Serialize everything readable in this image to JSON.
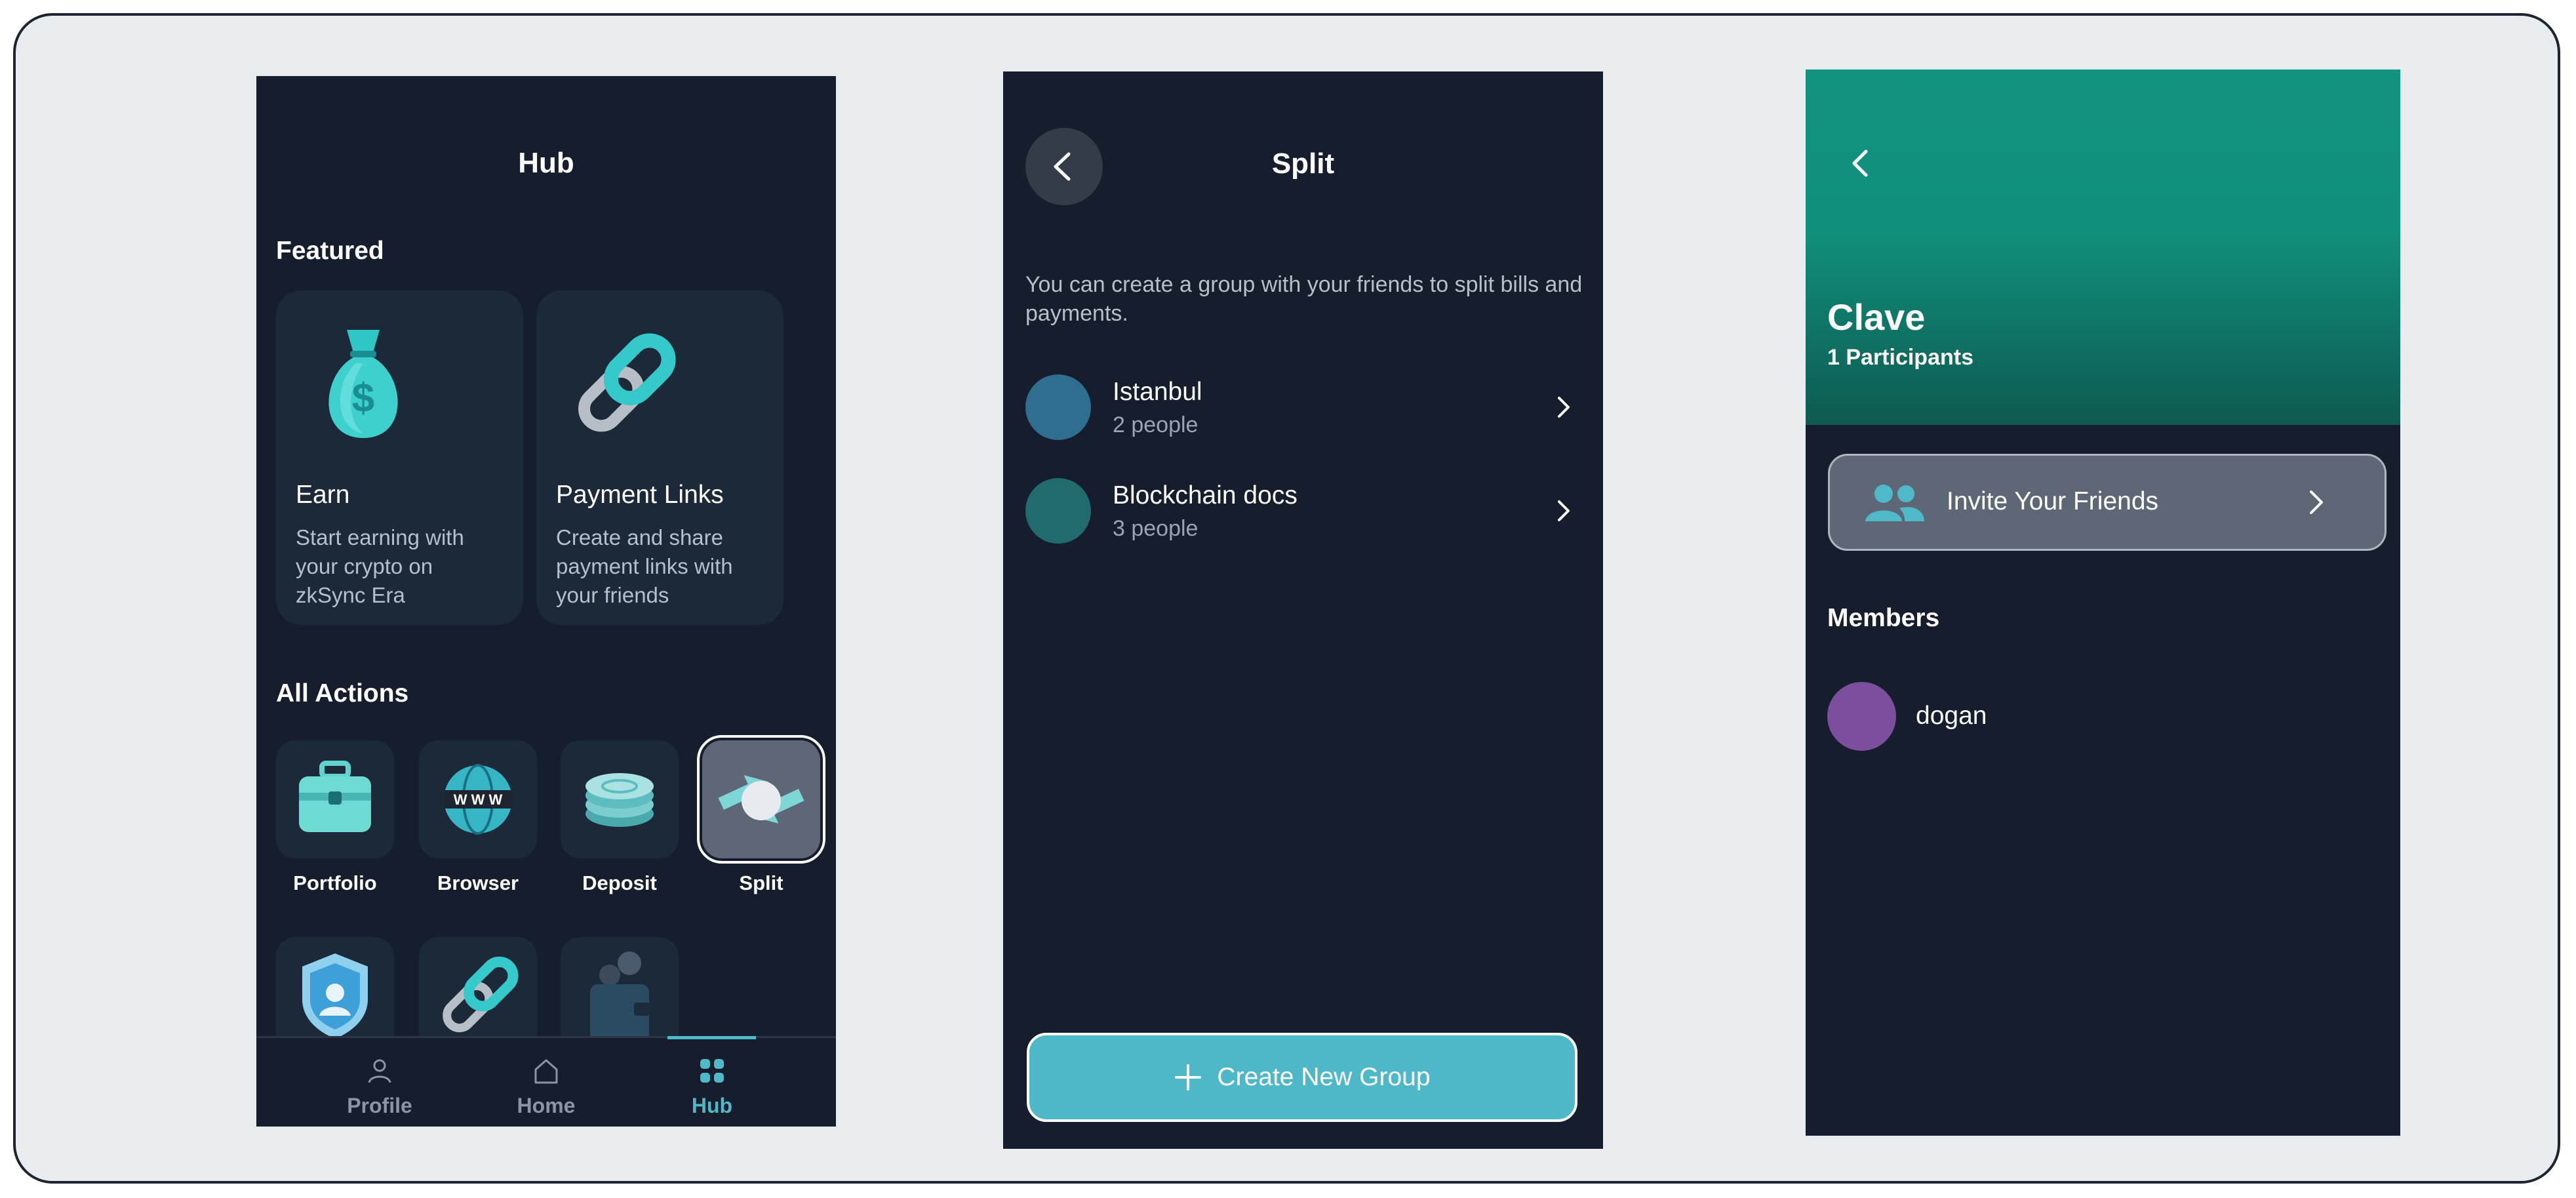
{
  "hub": {
    "title": "Hub",
    "featured_heading": "Featured",
    "featured": [
      {
        "title": "Earn",
        "description": "Start earning with your crypto on zkSync Era",
        "icon": "money-bag-icon"
      },
      {
        "title": "Payment Links",
        "description": "Create and share payment links with your friends",
        "icon": "chain-link-icon"
      }
    ],
    "actions_heading": "All Actions",
    "actions": [
      {
        "label": "Portfolio",
        "icon": "briefcase-icon"
      },
      {
        "label": "Browser",
        "icon": "globe-www-icon"
      },
      {
        "label": "Deposit",
        "icon": "coins-icon"
      },
      {
        "label": "Split",
        "icon": "split-arrows-icon",
        "selected": true
      }
    ],
    "more_actions_icons": [
      "shield-icon",
      "chain-link-icon",
      "wallet-icon"
    ],
    "tabs": [
      {
        "label": "Profile",
        "icon": "person-icon"
      },
      {
        "label": "Home",
        "icon": "home-icon"
      },
      {
        "label": "Hub",
        "icon": "grid-icon",
        "active": true
      }
    ]
  },
  "split": {
    "title": "Split",
    "description": "You can create a group with your friends to split bills and payments.",
    "groups": [
      {
        "name": "Istanbul",
        "count": "2 people",
        "color": "#2e6e8e"
      },
      {
        "name": "Blockchain docs",
        "count": "3 people",
        "color": "#216a6e"
      }
    ],
    "create_label": "Create New Group"
  },
  "group": {
    "title": "Clave",
    "participants": "1 Participants",
    "invite_label": "Invite Your Friends",
    "members_heading": "Members",
    "members": [
      {
        "name": "dogan",
        "color": "#7b4f9d"
      }
    ]
  },
  "colors": {
    "accent": "#4fb8c9",
    "background": "#161d2c",
    "card": "#1c2939",
    "hero_green": "#12937f"
  }
}
